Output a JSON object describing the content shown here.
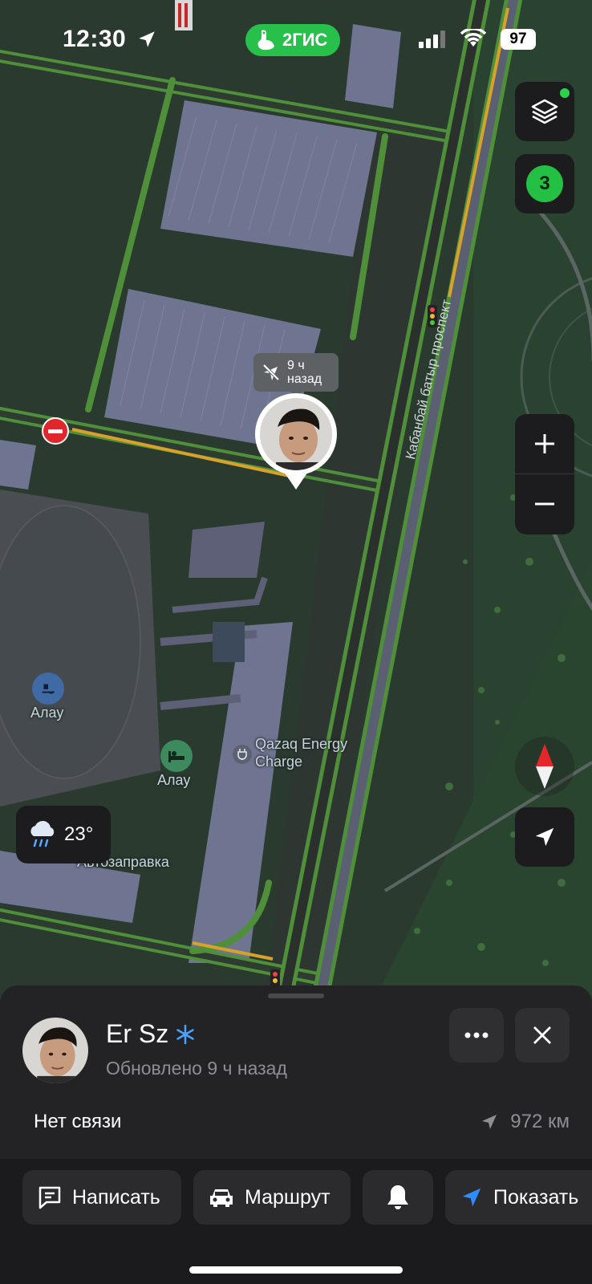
{
  "status": {
    "time": "12:30",
    "battery": "97",
    "brand": "2ГИС"
  },
  "map": {
    "street_label": "Кабанбай батыр проспект",
    "poi_alau_skating": "Алау",
    "poi_alau_hotel": "Алау",
    "poi_charge": "Qazaq Energy\nCharge",
    "poi_fuel": "Автозаправка",
    "pin_time_line1": "9 ч",
    "pin_time_line2": "назад",
    "friends_count": "3",
    "weather_temp": "23°"
  },
  "card": {
    "name": "Er Sz",
    "updated": "Обновлено 9 ч назад",
    "status": "Нет связи",
    "distance": "972 км"
  },
  "actions": {
    "message": "Написать",
    "route": "Маршрут",
    "show": "Показать"
  },
  "colors": {
    "brand_green": "#27c04a",
    "sheet_bg": "#232325",
    "road_green": "#4f8f3a",
    "traffic_orange": "#d7a22a",
    "accent_blue": "#2f8cff"
  },
  "icons": [
    "location-arrow-icon",
    "signal-icon",
    "wifi-icon",
    "layers-icon",
    "plus-icon",
    "minus-icon",
    "compass-icon",
    "my-location-icon",
    "rain-cloud-icon",
    "skating-icon",
    "bed-icon",
    "ev-charger-icon",
    "fuel-icon",
    "snowflake-icon",
    "more-icon",
    "close-icon",
    "message-icon",
    "car-icon",
    "bell-icon",
    "navigate-icon",
    "no-signal-icon"
  ]
}
